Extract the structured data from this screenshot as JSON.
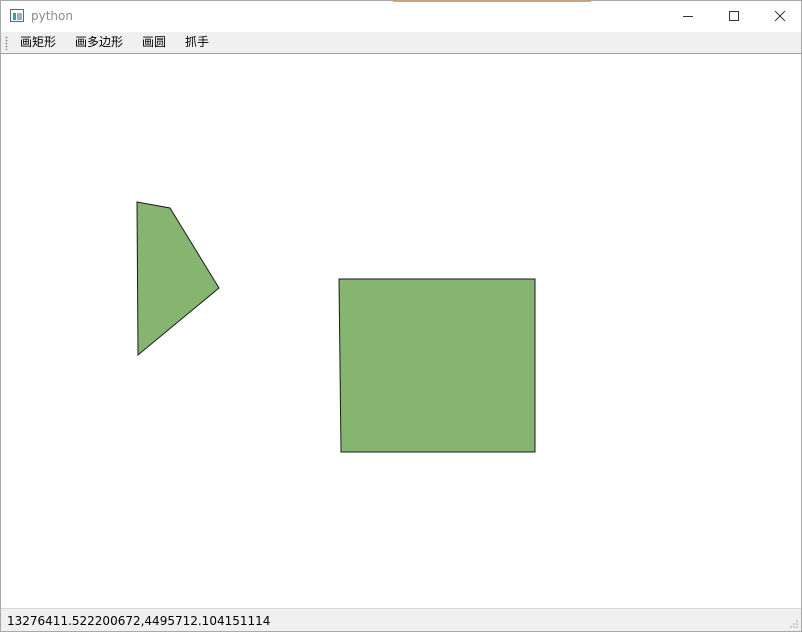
{
  "window": {
    "title": "python",
    "app_icon": "python-window-icon",
    "controls": {
      "minimize_icon": "minimize-icon",
      "maximize_icon": "maximize-icon",
      "close_icon": "close-icon"
    }
  },
  "menubar": {
    "items": [
      {
        "label": "画矩形"
      },
      {
        "label": "画多边形"
      },
      {
        "label": "画圆"
      },
      {
        "label": "抓手"
      }
    ]
  },
  "canvas": {
    "shape_fill": "#85b56f",
    "shape_stroke": "#1a1a1a",
    "shapes": [
      {
        "kind": "polygon"
      },
      {
        "kind": "rectangle"
      }
    ]
  },
  "statusbar": {
    "coordinates": "13276411.522200672,4495712.104151114"
  }
}
